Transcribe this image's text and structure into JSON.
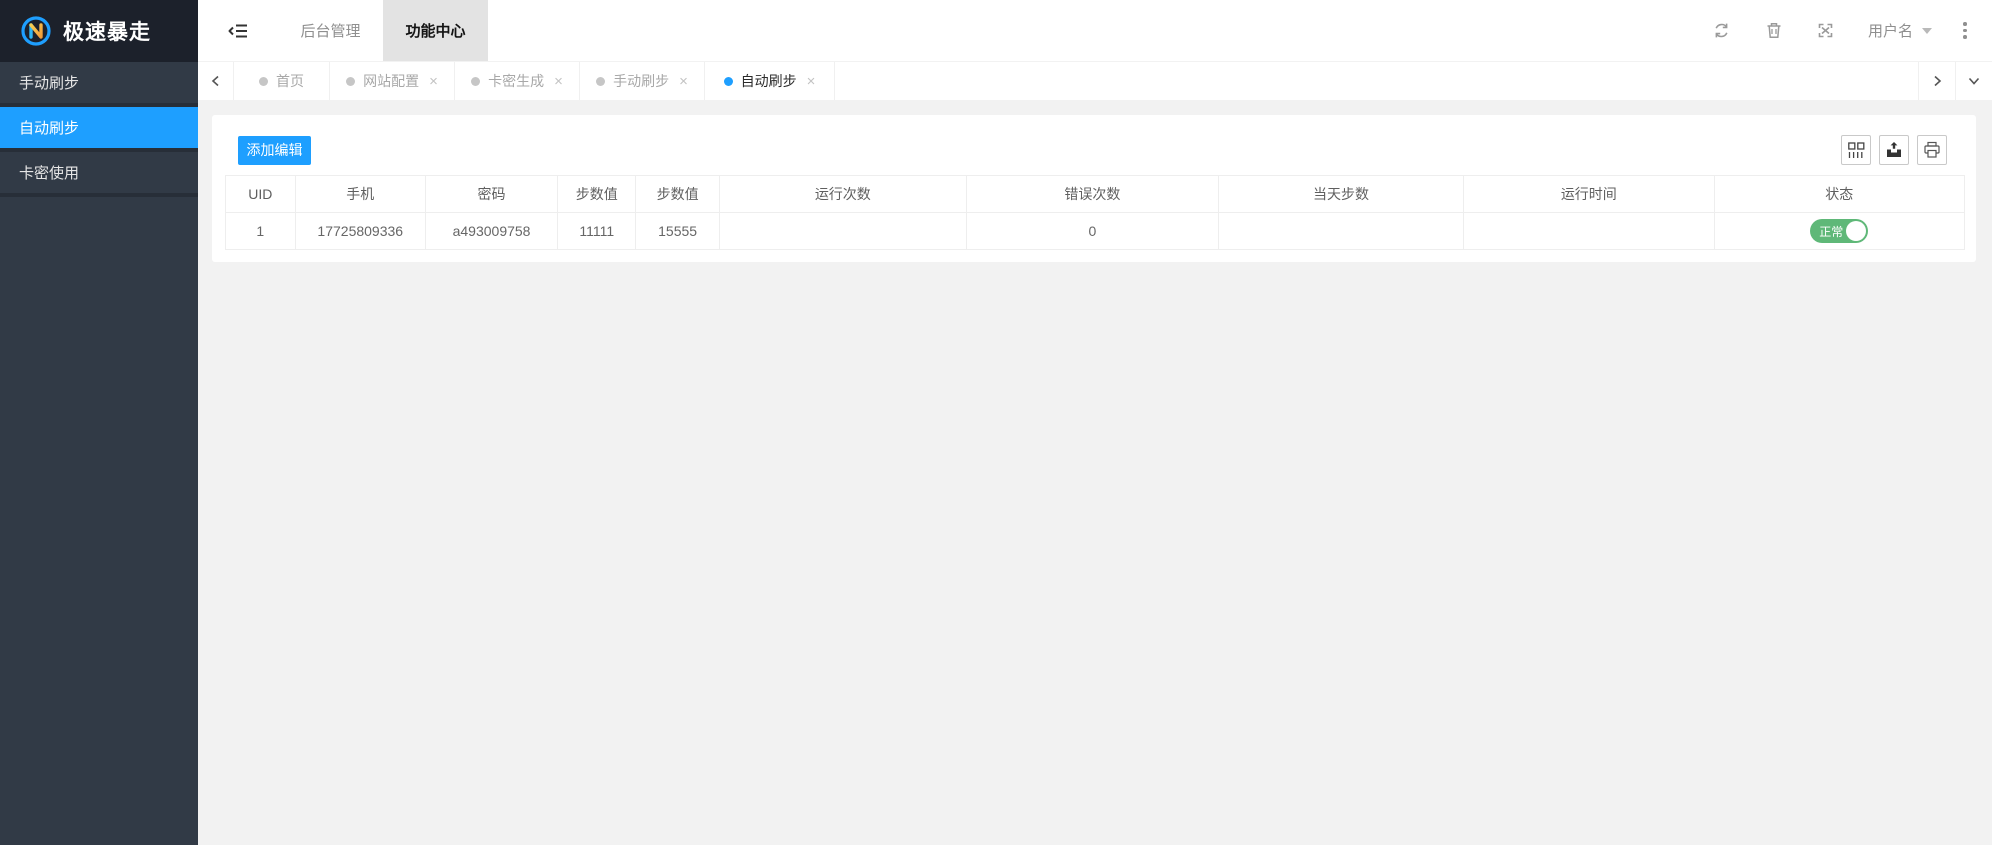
{
  "app": {
    "title": "极速暴走"
  },
  "sidebar": {
    "items": [
      {
        "label": "手动刷步",
        "active": false
      },
      {
        "label": "自动刷步",
        "active": true
      },
      {
        "label": "卡密使用",
        "active": false
      }
    ],
    "active_color": "#1E9FFF"
  },
  "header": {
    "nav": [
      {
        "label": "后台管理",
        "active": false
      },
      {
        "label": "功能中心",
        "active": true
      }
    ],
    "username": "用户名",
    "icons": [
      "refresh-icon",
      "recycle-icon",
      "fullscreen-icon",
      "more-vertical-icon"
    ],
    "nav_active_bg": "#E3E3E3"
  },
  "tabbar": {
    "tabs": [
      {
        "label": "首页",
        "closable": false,
        "active": false
      },
      {
        "label": "网站配置",
        "closable": true,
        "active": false
      },
      {
        "label": "卡密生成",
        "closable": true,
        "active": false
      },
      {
        "label": "手动刷步",
        "closable": true,
        "active": false
      },
      {
        "label": "自动刷步",
        "closable": true,
        "active": true
      }
    ],
    "close_glyph": "×"
  },
  "content": {
    "add_button_label": "添加编辑",
    "toolbar_icons": [
      "columns-filter-icon",
      "export-icon",
      "print-icon"
    ],
    "table": {
      "columns": [
        "UID",
        "手机",
        "密码",
        "步数值",
        "步数值",
        "运行次数",
        "错误次数",
        "当天步数",
        "运行时间",
        "状态"
      ],
      "rows": [
        {
          "cells": [
            "1",
            "17725809336",
            "a493009758",
            "11111",
            "15555",
            "",
            "0",
            "",
            ""
          ],
          "status": {
            "label": "正常",
            "on": true,
            "color": "#5FB878"
          }
        }
      ]
    }
  },
  "colors": {
    "accent": "#1E9FFF",
    "sidebar_bg": "#313A46",
    "logo_bg": "#1C212B",
    "content_bg": "#F2F2F2",
    "status_on": "#5FB878"
  }
}
